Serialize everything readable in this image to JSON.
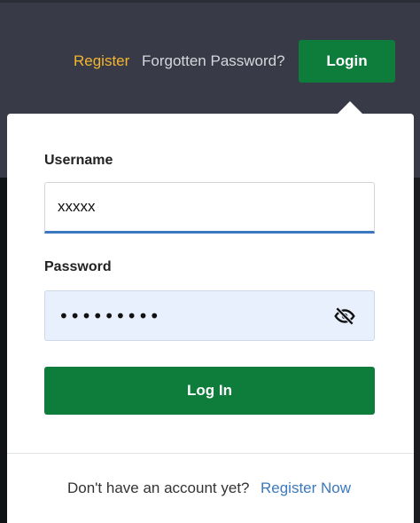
{
  "header": {
    "register_link": "Register",
    "forgot_link": "Forgotten Password?",
    "login_button": "Login"
  },
  "form": {
    "username_label": "Username",
    "username_value": "xxxxx",
    "password_label": "Password",
    "password_value": "•••••••••",
    "password_toggle_icon": "eye-off-icon",
    "submit_label": "Log In"
  },
  "footer": {
    "prompt": "Don't have an account yet?",
    "register_link": "Register Now"
  },
  "colors": {
    "primary_green": "#0e7c3a",
    "accent_yellow": "#f2b630",
    "link_blue": "#3a79bf",
    "header_bg": "#383a47",
    "autofill_bg": "#e8f0fe"
  }
}
